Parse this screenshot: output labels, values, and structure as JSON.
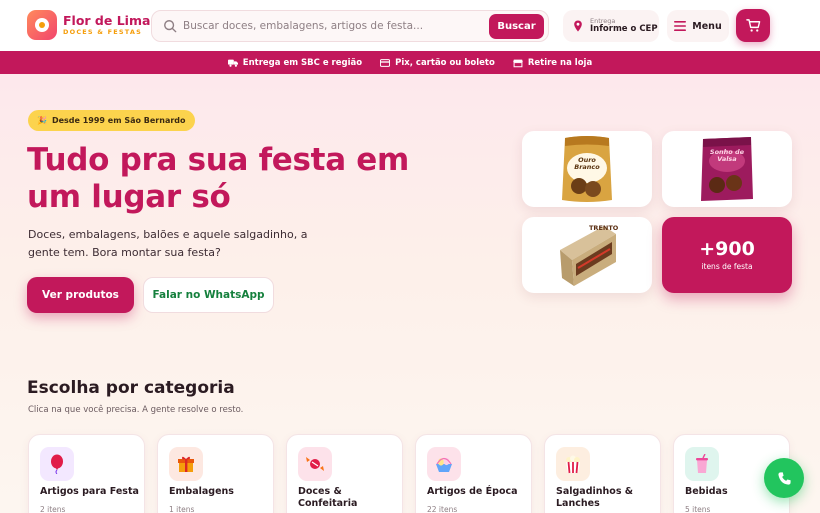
{
  "brand": {
    "name": "Flor de Lima",
    "tagline": "DOCES & FESTAS"
  },
  "search": {
    "placeholder": "Buscar doces, embalagens, artigos de festa...",
    "button": "Buscar"
  },
  "delivery": {
    "small": "Entrega",
    "main": "Informe o CEP"
  },
  "menu": {
    "label": "Menu"
  },
  "infobar": [
    {
      "icon": "truck-icon",
      "label": "Entrega em SBC e região"
    },
    {
      "icon": "card-icon",
      "label": "Pix, cartão ou boleto"
    },
    {
      "icon": "store-icon",
      "label": "Retire na loja"
    }
  ],
  "hero": {
    "badge": "Desde 1999 em São Bernardo",
    "title": "Tudo pra sua festa em um lugar só",
    "description": "Doces, embalagens, balões e aquele salgadinho, a gente tem. Bora montar sua festa?",
    "primary_button": "Ver produtos",
    "secondary_button": "Falar no WhatsApp",
    "products": [
      {
        "name": "Ouro Branco"
      },
      {
        "name": "Sonho de Valsa"
      },
      {
        "name": "TRENTO"
      }
    ],
    "count_value": "+900",
    "count_label": "itens de festa"
  },
  "categories": {
    "title": "Escolha por categoria",
    "subtitle": "Clica na que você precisa. A gente resolve o resto.",
    "items": [
      {
        "name": "Artigos para Festa",
        "count": "2 itens",
        "icon": "balloon-icon",
        "bg": "#f3e8ff"
      },
      {
        "name": "Embalagens",
        "count": "1 itens",
        "icon": "gift-icon",
        "bg": "#fde8e1"
      },
      {
        "name": "Doces & Confeitaria",
        "count": "",
        "icon": "candy-icon",
        "bg": "#fde2ea"
      },
      {
        "name": "Artigos de Época",
        "count": "22 itens",
        "icon": "easter-icon",
        "bg": "#fde2ea"
      },
      {
        "name": "Salgadinhos & Lanches",
        "count": "",
        "icon": "popcorn-icon",
        "bg": "#fdeee0"
      },
      {
        "name": "Bebidas",
        "count": "5 itens",
        "icon": "drink-icon",
        "bg": "#dff5ee"
      }
    ]
  },
  "colors": {
    "primary": "#c2185b",
    "accent": "#f59e0b",
    "whatsapp": "#22c55e",
    "badge": "#fcd34d"
  }
}
